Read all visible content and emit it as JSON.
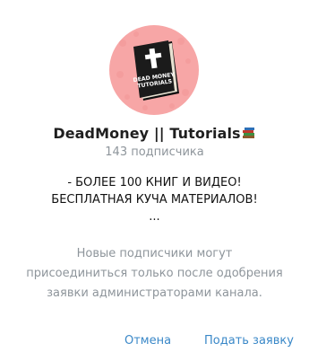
{
  "channel": {
    "name": "DeadMoney || Tutorials",
    "subscribers": "143 подписчика",
    "avatar_text_line1": "DEAD MONEY",
    "avatar_text_line2": "TUTORIALS"
  },
  "description": {
    "line1": "- БОЛЕЕ 100 КНИГ И ВИДЕО!",
    "line2": "БЕСПЛАТНАЯ КУЧА МАТЕРИАЛОВ!",
    "line3": "..."
  },
  "notice": {
    "line1": "Новые подписчики могут",
    "line2": "присоединиться только после одобрения",
    "line3": "заявки администраторами канала."
  },
  "buttons": {
    "cancel": "Отмена",
    "request": "Подать заявку"
  },
  "icons": {
    "avatar": "book-cross-icon",
    "name_emoji": "books-icon"
  },
  "colors": {
    "accent": "#3a88c8",
    "muted": "#8e959b",
    "avatar_bg": "#f7a6a6",
    "book": "#1b1b1b"
  }
}
